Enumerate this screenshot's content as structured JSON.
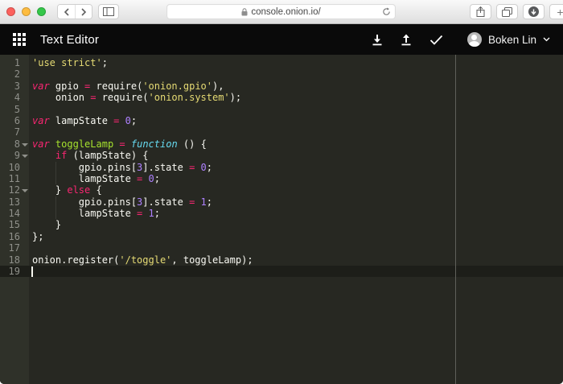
{
  "browser": {
    "url": "console.onion.io/",
    "window_buttons": [
      "close",
      "minimize",
      "zoom"
    ],
    "toolbar_icons": [
      "back",
      "forward",
      "sidebar",
      "lock",
      "reload",
      "share",
      "tabs",
      "downloads",
      "new-tab"
    ],
    "new_tab_label": "+"
  },
  "header": {
    "title": "Text Editor",
    "toolbar_icons": [
      "apps-grid",
      "download",
      "upload",
      "check"
    ],
    "user": {
      "name": "Boken Lin"
    }
  },
  "editor": {
    "colors": {
      "bg": "#272822",
      "gutterBg": "#2f3129",
      "gutterFg": "#8f908a",
      "activeLine": "#1d1e19",
      "printMargin": "#60615a",
      "plain": "#f8f8f2",
      "str": "#e6db74",
      "kw": "#f92672",
      "kwfn": "#66d9ef",
      "num": "#ae81ff",
      "fn": "#a6e22e"
    },
    "lines": [
      {
        "n": 1,
        "tokens": [
          [
            "str",
            "'use strict'"
          ],
          [
            "plain",
            ";"
          ]
        ]
      },
      {
        "n": 2,
        "tokens": []
      },
      {
        "n": 3,
        "tokens": [
          [
            "kwvar",
            "var"
          ],
          [
            "plain",
            " gpio "
          ],
          [
            "op",
            "="
          ],
          [
            "plain",
            " require("
          ],
          [
            "str",
            "'onion.gpio'"
          ],
          [
            "plain",
            "),"
          ]
        ]
      },
      {
        "n": 4,
        "tokens": [
          [
            "plain",
            "    onion "
          ],
          [
            "op",
            "="
          ],
          [
            "plain",
            " require("
          ],
          [
            "str",
            "'onion.system'"
          ],
          [
            "plain",
            ");"
          ]
        ]
      },
      {
        "n": 5,
        "tokens": []
      },
      {
        "n": 6,
        "tokens": [
          [
            "kwvar",
            "var"
          ],
          [
            "plain",
            " lampState "
          ],
          [
            "op",
            "="
          ],
          [
            "plain",
            " "
          ],
          [
            "num",
            "0"
          ],
          [
            "plain",
            ";"
          ]
        ]
      },
      {
        "n": 7,
        "tokens": []
      },
      {
        "n": 8,
        "fold": true,
        "tokens": [
          [
            "kwvar",
            "var"
          ],
          [
            "plain",
            " "
          ],
          [
            "fn",
            "toggleLamp"
          ],
          [
            "plain",
            " "
          ],
          [
            "op",
            "="
          ],
          [
            "plain",
            " "
          ],
          [
            "kwfn",
            "function"
          ],
          [
            "plain",
            " () {"
          ]
        ]
      },
      {
        "n": 9,
        "fold": true,
        "tokens": [
          [
            "plain",
            "    "
          ],
          [
            "kw",
            "if"
          ],
          [
            "plain",
            " (lampState) {"
          ]
        ]
      },
      {
        "n": 10,
        "guide": true,
        "tokens": [
          [
            "plain",
            "        gpio.pins["
          ],
          [
            "num",
            "3"
          ],
          [
            "plain",
            "].state "
          ],
          [
            "op",
            "="
          ],
          [
            "plain",
            " "
          ],
          [
            "num",
            "0"
          ],
          [
            "plain",
            ";"
          ]
        ]
      },
      {
        "n": 11,
        "guide": true,
        "tokens": [
          [
            "plain",
            "        lampState "
          ],
          [
            "op",
            "="
          ],
          [
            "plain",
            " "
          ],
          [
            "num",
            "0"
          ],
          [
            "plain",
            ";"
          ]
        ]
      },
      {
        "n": 12,
        "fold": true,
        "tokens": [
          [
            "plain",
            "    } "
          ],
          [
            "kw",
            "else"
          ],
          [
            "plain",
            " {"
          ]
        ]
      },
      {
        "n": 13,
        "guide": true,
        "tokens": [
          [
            "plain",
            "        gpio.pins["
          ],
          [
            "num",
            "3"
          ],
          [
            "plain",
            "].state "
          ],
          [
            "op",
            "="
          ],
          [
            "plain",
            " "
          ],
          [
            "num",
            "1"
          ],
          [
            "plain",
            ";"
          ]
        ]
      },
      {
        "n": 14,
        "guide": true,
        "tokens": [
          [
            "plain",
            "        lampState "
          ],
          [
            "op",
            "="
          ],
          [
            "plain",
            " "
          ],
          [
            "num",
            "1"
          ],
          [
            "plain",
            ";"
          ]
        ]
      },
      {
        "n": 15,
        "tokens": [
          [
            "plain",
            "    }"
          ]
        ]
      },
      {
        "n": 16,
        "tokens": [
          [
            "plain",
            "};"
          ]
        ]
      },
      {
        "n": 17,
        "tokens": []
      },
      {
        "n": 18,
        "tokens": [
          [
            "plain",
            "onion.register("
          ],
          [
            "str",
            "'/toggle'"
          ],
          [
            "plain",
            ", toggleLamp);"
          ]
        ]
      },
      {
        "n": 19,
        "active": true,
        "cursor": true,
        "tokens": []
      }
    ]
  }
}
